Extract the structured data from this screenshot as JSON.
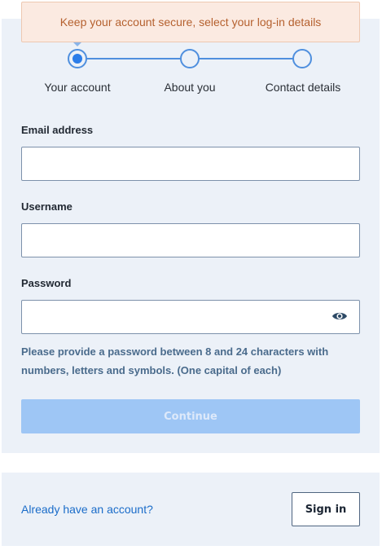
{
  "tooltip": {
    "text": "Keep your account secure, select your log-in details"
  },
  "stepper": {
    "steps": [
      {
        "label": "Your account",
        "active": true
      },
      {
        "label": "About you",
        "active": false
      },
      {
        "label": "Contact details",
        "active": false
      }
    ]
  },
  "form": {
    "email": {
      "label": "Email address",
      "value": ""
    },
    "username": {
      "label": "Username",
      "value": ""
    },
    "password": {
      "label": "Password",
      "value": "",
      "toggle_icon": "eye-icon"
    },
    "hint": "Please provide a password between 8 and 24 characters with numbers, letters and symbols. (One capital of each)",
    "continue_label": "Continue"
  },
  "footer": {
    "prompt": "Already have an account?",
    "signin_label": "Sign in"
  },
  "colors": {
    "accent": "#2b7de9",
    "panel_bg": "#ecf1f8",
    "tooltip_bg": "#fbeae1",
    "tooltip_text": "#b5612f",
    "button_disabled": "#9ec6f5",
    "link": "#1a6cc9"
  }
}
